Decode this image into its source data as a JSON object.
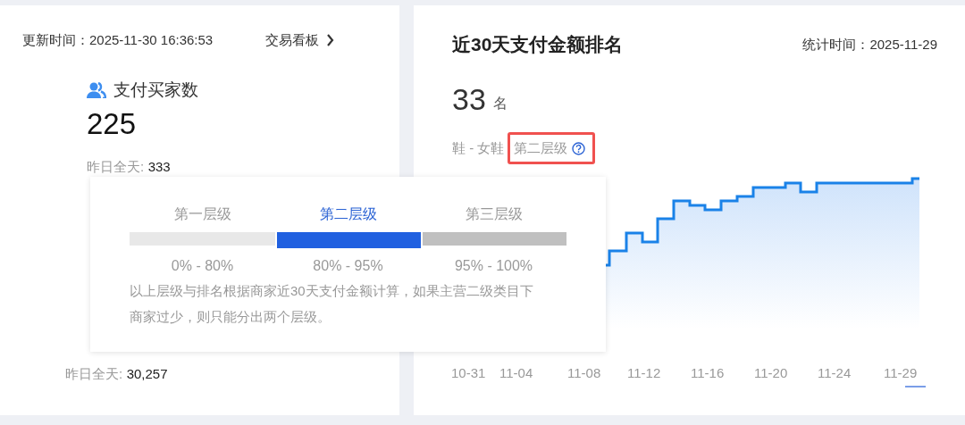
{
  "header": {
    "update_time": "更新时间：2025-11-30 16:36:53",
    "link": "交易看板"
  },
  "metric": {
    "title": "支付买家数",
    "value": "225",
    "yesterday_label": "昨日全天:",
    "yesterday_value": "333"
  },
  "metric_bottom": {
    "label": "昨日全天:",
    "value": "30,257"
  },
  "ranking": {
    "title": "近30天支付金额排名",
    "stat_time": "统计时间：2025-11-29",
    "rank": "33",
    "unit": "名",
    "category": "鞋 - 女鞋",
    "tier": "第二层级",
    "x_labels": [
      "10-31",
      "11-04",
      "11-08",
      "11-12",
      "11-16",
      "11-20",
      "11-24",
      "11-29"
    ]
  },
  "tooltip": {
    "tiers": [
      {
        "label": "第一层级",
        "range": "0% - 80%",
        "selected": false,
        "color": "#e8e8e8"
      },
      {
        "label": "第二层级",
        "range": "80% - 95%",
        "selected": true,
        "color": "#2060e0"
      },
      {
        "label": "第三层级",
        "range": "95% - 100%",
        "selected": false,
        "color": "#c0c0c0"
      }
    ],
    "note": "以上层级与排名根据商家近30天支付金额计算，如果主营二级类目下商家过少，则只能分出两个层级。"
  }
}
